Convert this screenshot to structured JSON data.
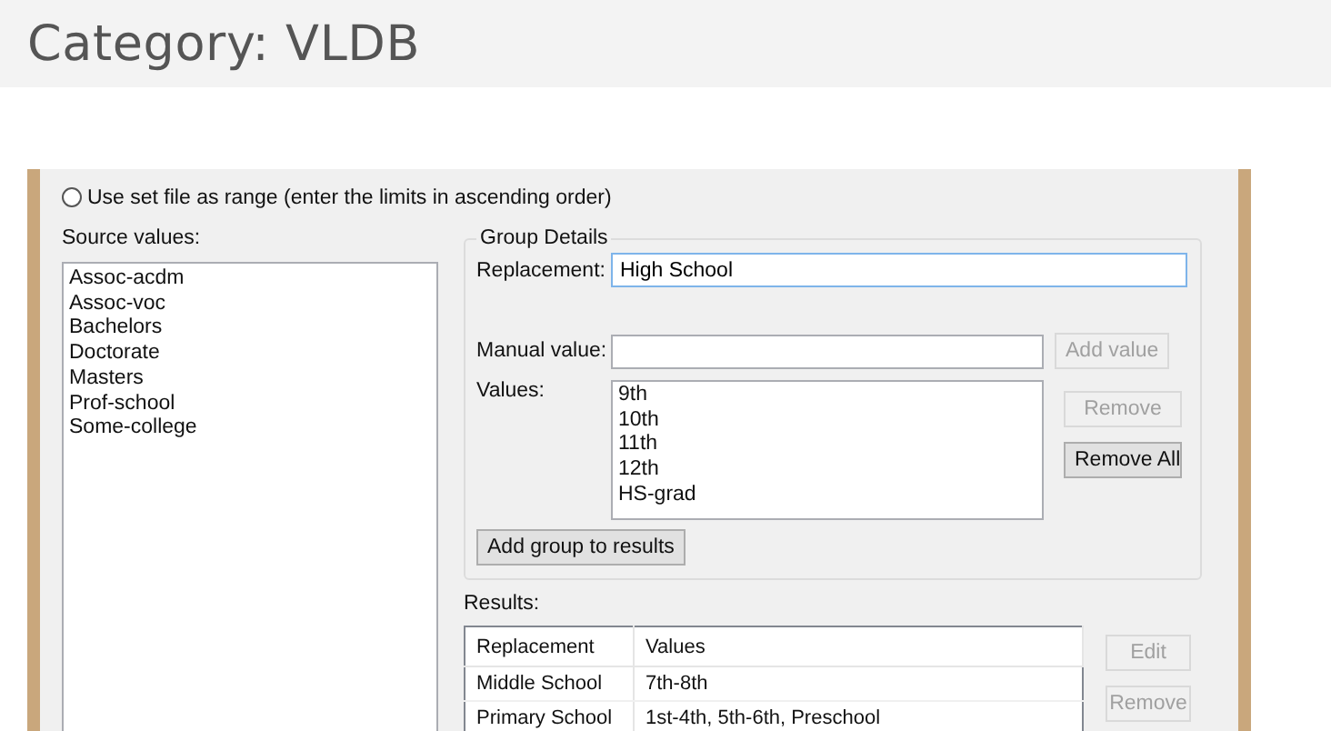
{
  "page_title": "Category: VLDB",
  "dialog": {
    "radio_option": {
      "label": "Use set file as range (enter the limits in ascending order)",
      "selected": false
    },
    "source_values": {
      "label": "Source values:",
      "items": [
        "Assoc-acdm",
        "Assoc-voc",
        "Bachelors",
        "Doctorate",
        "Masters",
        "Prof-school",
        "Some-college"
      ]
    },
    "group_details": {
      "legend": "Group Details",
      "replacement": {
        "label": "Replacement:",
        "value": "High School"
      },
      "manual_value": {
        "label": "Manual value:"
      },
      "add_value_button": {
        "label": "Add value",
        "disabled": true
      },
      "values": {
        "label": "Values:",
        "items": [
          "9th",
          "10th",
          "11th",
          "12th",
          "HS-grad"
        ]
      },
      "remove_button": {
        "label": "Remove",
        "disabled": true
      },
      "remove_all_button": {
        "label": "Remove All",
        "disabled": false
      },
      "add_group_button": {
        "label": "Add group to results",
        "disabled": false
      }
    },
    "results": {
      "label": "Results:",
      "columns": [
        "Replacement",
        "Values"
      ],
      "rows": [
        [
          "Middle School",
          "7th-8th"
        ],
        [
          "Primary School",
          "1st-4th, 5th-6th, Preschool"
        ]
      ],
      "buttons": [
        {
          "label": "Edit",
          "disabled": true
        },
        {
          "label": "Remove",
          "disabled": true
        }
      ]
    }
  }
}
